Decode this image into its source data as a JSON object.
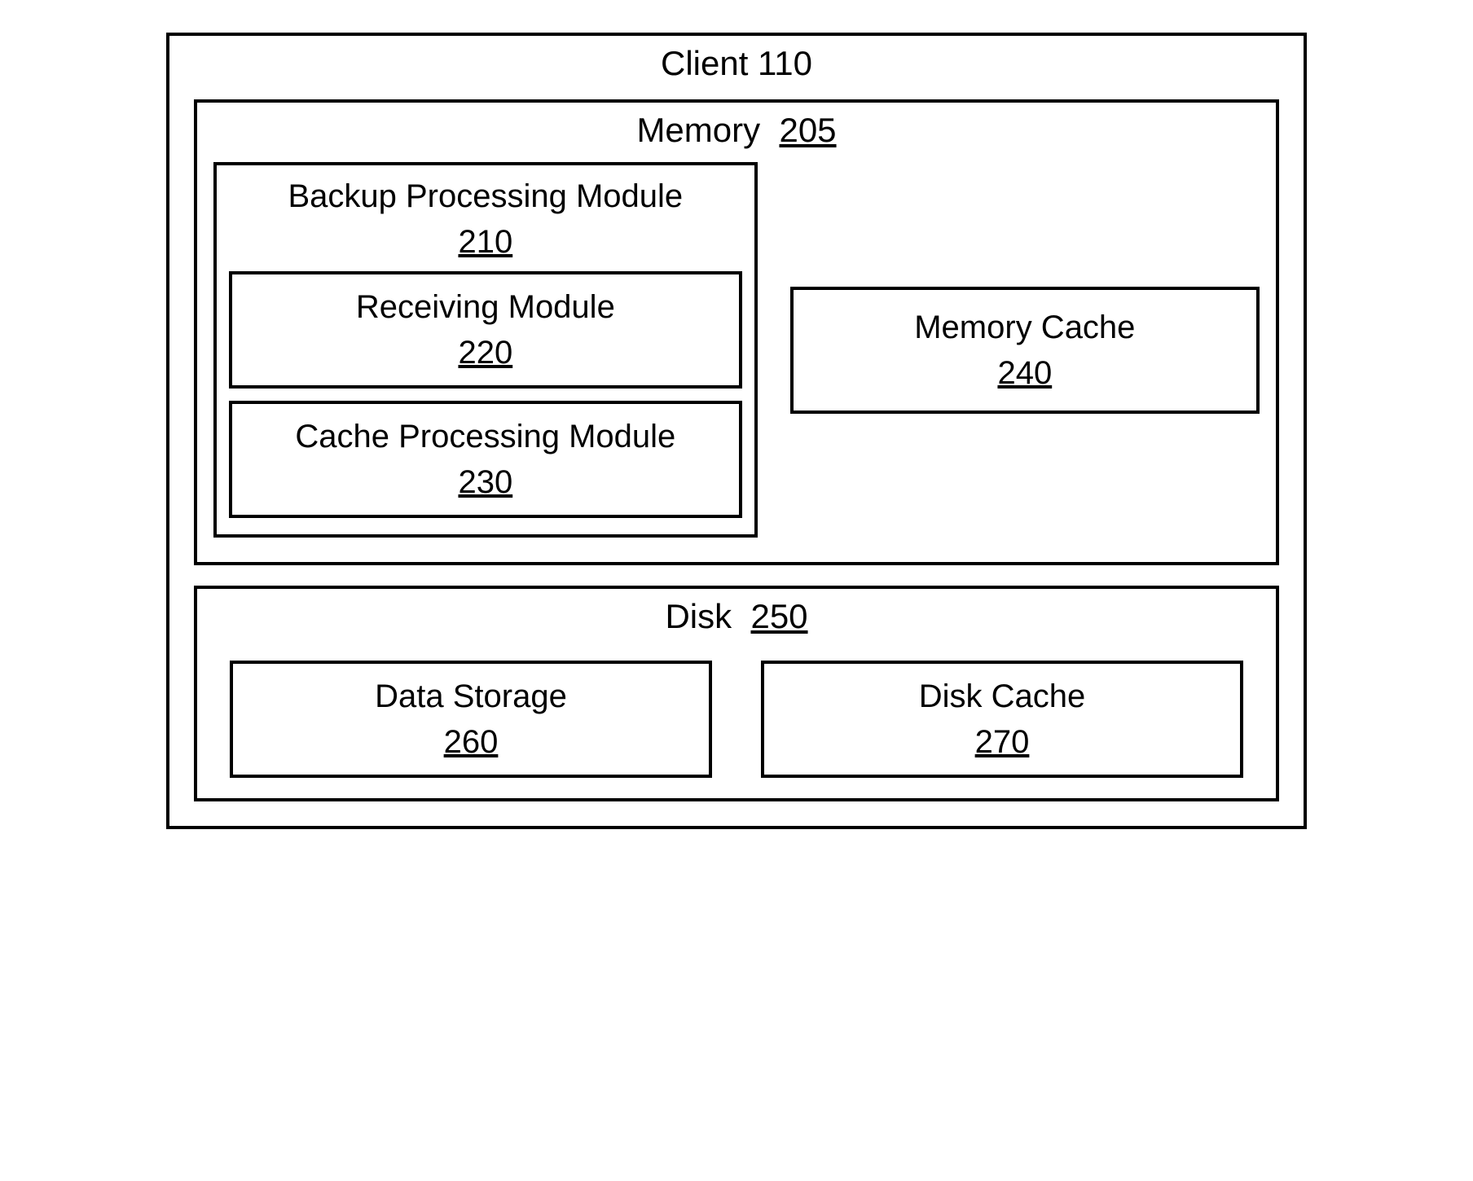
{
  "client": {
    "label": "Client",
    "num": "110"
  },
  "memory": {
    "label": "Memory",
    "num": "205",
    "backup_module": {
      "label": "Backup Processing Module",
      "num": "210",
      "receiving": {
        "label": "Receiving Module",
        "num": "220"
      },
      "cache_processing": {
        "label": "Cache Processing Module",
        "num": "230"
      }
    },
    "memory_cache": {
      "label": "Memory Cache",
      "num": "240"
    }
  },
  "disk": {
    "label": "Disk",
    "num": "250",
    "data_storage": {
      "label": "Data Storage",
      "num": "260"
    },
    "disk_cache": {
      "label": "Disk Cache",
      "num": "270"
    }
  }
}
